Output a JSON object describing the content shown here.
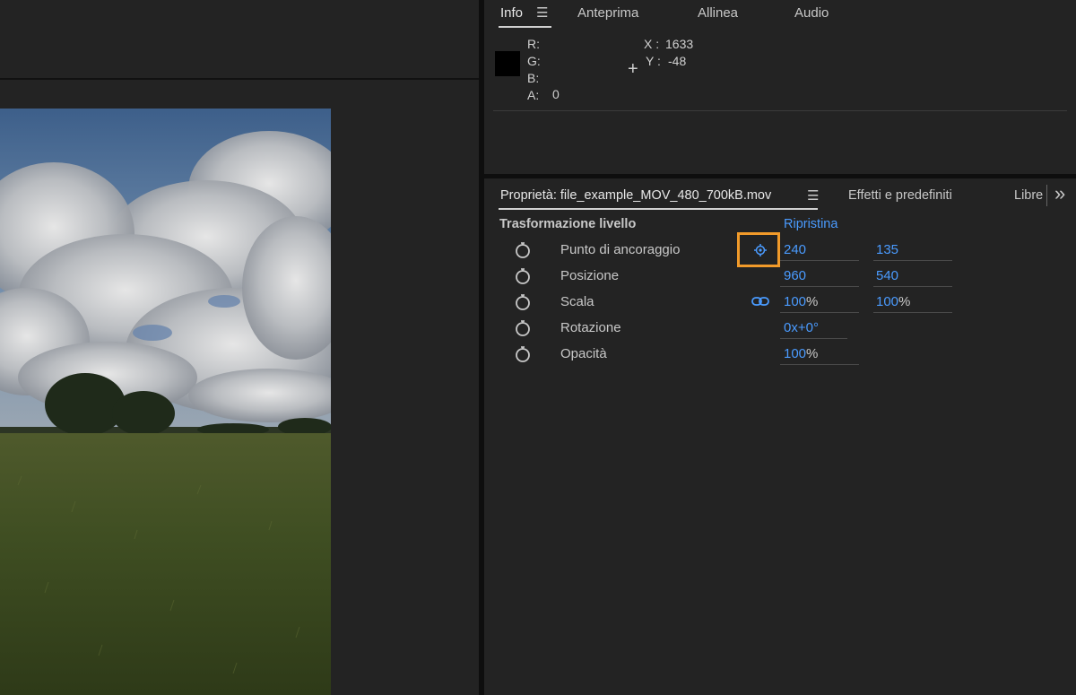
{
  "info_panel": {
    "tabs": [
      {
        "label": "Info",
        "active": true
      },
      {
        "label": "Anteprima"
      },
      {
        "label": "Allinea"
      },
      {
        "label": "Audio"
      }
    ],
    "menu_icon": "hamburger-icon",
    "r_label": "R:",
    "g_label": "G:",
    "b_label": "B:",
    "a_label": "A:",
    "a_value": "0",
    "x_label": "X :",
    "x_value": "1633",
    "y_label": "Y :",
    "y_value": "-48",
    "crosshair": "+"
  },
  "properties_panel": {
    "tab_label": "Proprietà: file_example_MOV_480_700kB.mov",
    "effects_tab": "Effetti e predefiniti",
    "libraries_tab": "Libre",
    "overflow": "»",
    "section_title": "Trasformazione livello",
    "reset_label": "Ripristina",
    "rows": [
      {
        "label": "Punto di ancoraggio",
        "v1": "240",
        "v2": "135"
      },
      {
        "label": "Posizione",
        "v1": "960",
        "v2": "540"
      },
      {
        "label": "Scala",
        "v1": "100",
        "u1": "%",
        "v2": "100",
        "u2": "%"
      },
      {
        "label": "Rotazione",
        "v1": "0x+0°"
      },
      {
        "label": "Opacità",
        "v1": "100",
        "u1": "%"
      }
    ]
  },
  "colors": {
    "accent_blue": "#4a9bff",
    "highlight_orange": "#f19a2a"
  }
}
